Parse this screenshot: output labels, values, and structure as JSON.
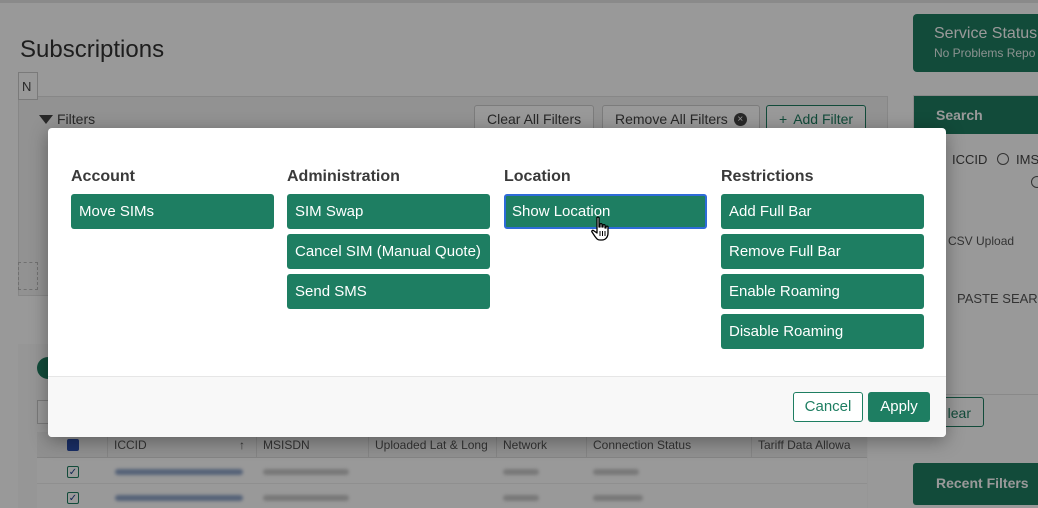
{
  "page": {
    "title": "Subscriptions"
  },
  "filters": {
    "label": "Filters",
    "clear_all": "Clear All Filters",
    "remove_all": "Remove All Filters",
    "add_filter": "Add Filter",
    "partial_field": "N"
  },
  "table": {
    "columns": [
      "ICCID",
      "MSISDN",
      "Uploaded Lat & Long",
      "Network",
      "Connection Status",
      "Tariff Data Allowa"
    ]
  },
  "service_status": {
    "title": "Service Status",
    "subtitle": "No Problems Repo"
  },
  "search": {
    "title": "Search",
    "radio_iccid": "ICCID",
    "radio_ims": "IMS",
    "csv_upload": "CSV Upload",
    "paste_search": "PASTE SEARC",
    "clear": "lear"
  },
  "recent_filters": "Recent Filters",
  "modal": {
    "columns": [
      {
        "title": "Account",
        "actions": [
          "Move SIMs"
        ]
      },
      {
        "title": "Administration",
        "actions": [
          "SIM Swap",
          "Cancel SIM (Manual Quote)",
          "Send SMS"
        ]
      },
      {
        "title": "Location",
        "actions": [
          "Show Location"
        ]
      },
      {
        "title": "Restrictions",
        "actions": [
          "Add Full Bar",
          "Remove Full Bar",
          "Enable Roaming",
          "Disable Roaming"
        ]
      }
    ],
    "selected_action": "Show Location",
    "cancel": "Cancel",
    "apply": "Apply"
  },
  "colors": {
    "accent": "#1e7e62",
    "selection_border": "#2e6bd8"
  },
  "icons": {
    "filter": "funnel-icon",
    "remove": "x-circle-icon",
    "add": "plus-icon",
    "cursor": "hand-pointer-icon"
  }
}
